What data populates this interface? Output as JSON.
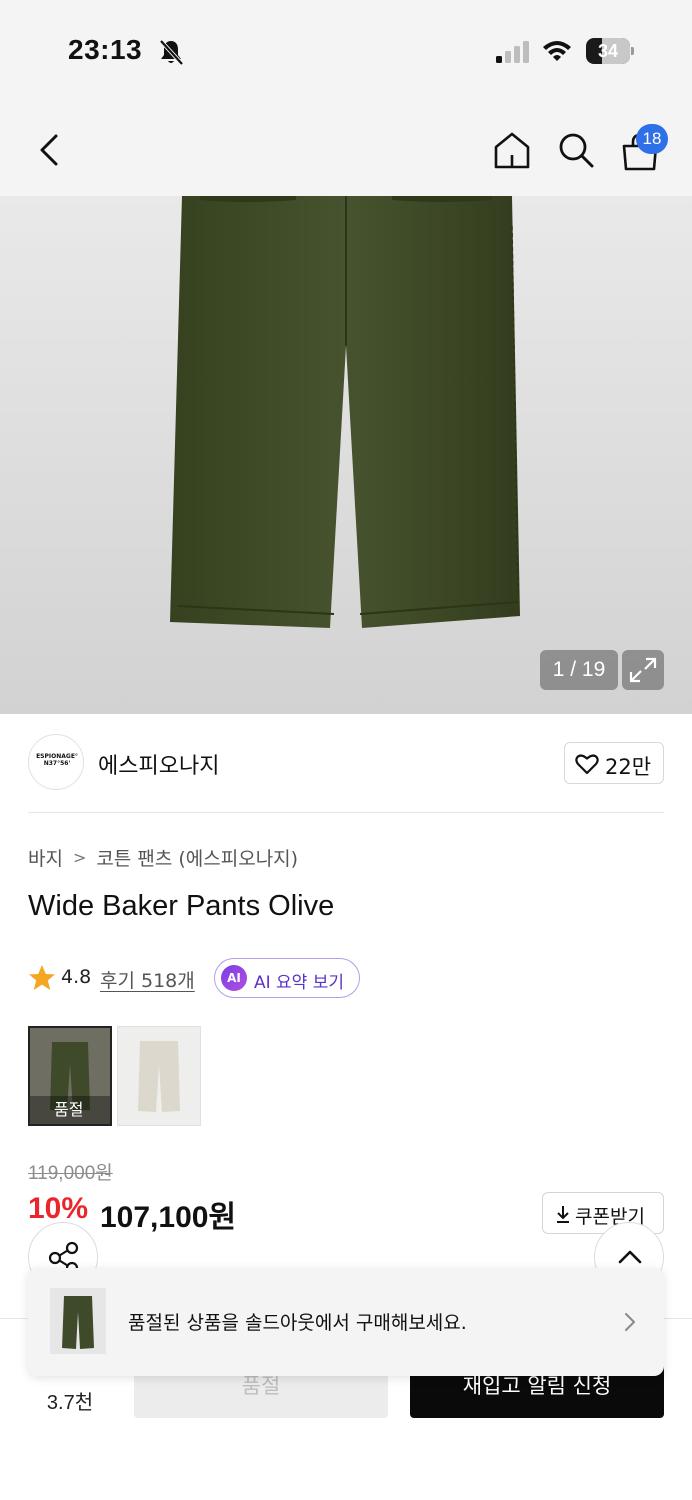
{
  "status_bar": {
    "time": "23:13",
    "battery_level": "34",
    "icons": [
      "bell-off-icon",
      "cellular-signal-icon",
      "wifi-icon",
      "battery-icon"
    ]
  },
  "nav": {
    "icons": [
      "back-icon",
      "home-icon",
      "search-icon",
      "cart-icon"
    ],
    "cart_badge": "18"
  },
  "gallery": {
    "counter": "1 / 19",
    "expand_icon": "expand-icon"
  },
  "brand": {
    "logo_text_line1": "ESPIONAGE°",
    "logo_text_line2": "N37°56'",
    "name": "에스피오나지",
    "like_count": "22만"
  },
  "breadcrumb": {
    "category": "바지",
    "separator": ">",
    "subcategory": "코튼 팬츠 (에스피오나지)"
  },
  "product": {
    "title": "Wide Baker Pants Olive",
    "rating": "4.8",
    "review_link": "후기 518개",
    "ai_badge": "AI",
    "ai_summary_label": "AI 요약 보기"
  },
  "swatches": [
    {
      "color": "#3f4a2b",
      "label": "품절"
    },
    {
      "color": "#dcd8cd",
      "label": ""
    }
  ],
  "price": {
    "original": "119,000원",
    "discount": "10%",
    "sale": "107,100원",
    "coupon_label": "쿠폰받기"
  },
  "toast": {
    "message": "품절된 상품을 솔드아웃에서 구매해보세요."
  },
  "bottom_bar": {
    "wish_count": "3.7천",
    "soldout_label": "품절",
    "restock_label": "재입고 알림 신청"
  },
  "colors": {
    "accent_red": "#e8262b",
    "badge_blue": "#2f6fe8",
    "ai_purple": "#7b3fe4",
    "star": "#f5a623",
    "olive": "#3f4a2b"
  }
}
